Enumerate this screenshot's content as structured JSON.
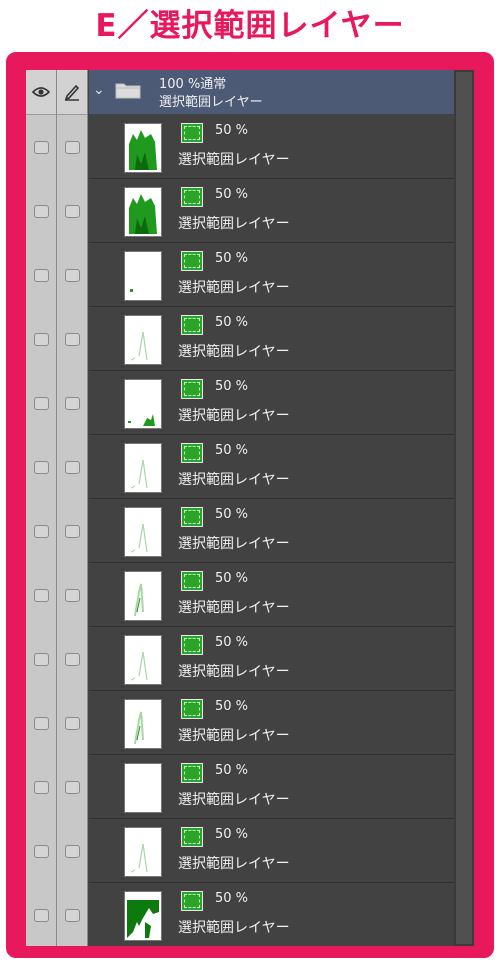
{
  "title": "E／選択範囲レイヤー",
  "colors": {
    "accent": "#e8185c",
    "group_header": "#4d5a76",
    "panel": "#424242",
    "mask": "#2aa52a"
  },
  "columns": {
    "visibility_icon": "eye-icon",
    "edit_icon": "pen-icon"
  },
  "group": {
    "expand_icon": "chevron-down-icon",
    "folder_icon": "folder-icon",
    "blend": "100 %通常",
    "name": "選択範囲レイヤー"
  },
  "layers": [
    {
      "opacity": "50 %",
      "name": "選択範囲レイヤー",
      "mask_icon": "layer-mask-icon",
      "thumb": "dense"
    },
    {
      "opacity": "50 %",
      "name": "選択範囲レイヤー",
      "mask_icon": "layer-mask-icon",
      "thumb": "dense"
    },
    {
      "opacity": "50 %",
      "name": "選択範囲レイヤー",
      "mask_icon": "layer-mask-icon",
      "thumb": "dot"
    },
    {
      "opacity": "50 %",
      "name": "選択範囲レイヤー",
      "mask_icon": "layer-mask-icon",
      "thumb": "faint"
    },
    {
      "opacity": "50 %",
      "name": "選択範囲レイヤー",
      "mask_icon": "layer-mask-icon",
      "thumb": "bottom-right"
    },
    {
      "opacity": "50 %",
      "name": "選択範囲レイヤー",
      "mask_icon": "layer-mask-icon",
      "thumb": "faint"
    },
    {
      "opacity": "50 %",
      "name": "選択範囲レイヤー",
      "mask_icon": "layer-mask-icon",
      "thumb": "faint"
    },
    {
      "opacity": "50 %",
      "name": "選択範囲レイヤー",
      "mask_icon": "layer-mask-icon",
      "thumb": "stroke"
    },
    {
      "opacity": "50 %",
      "name": "選択範囲レイヤー",
      "mask_icon": "layer-mask-icon",
      "thumb": "faint"
    },
    {
      "opacity": "50 %",
      "name": "選択範囲レイヤー",
      "mask_icon": "layer-mask-icon",
      "thumb": "stroke"
    },
    {
      "opacity": "50 %",
      "name": "選択範囲レイヤー",
      "mask_icon": "layer-mask-icon",
      "thumb": "empty"
    },
    {
      "opacity": "50 %",
      "name": "選択範囲レイヤー",
      "mask_icon": "layer-mask-icon",
      "thumb": "faint"
    },
    {
      "opacity": "50 %",
      "name": "選択範囲レイヤー",
      "mask_icon": "layer-mask-icon",
      "thumb": "blob"
    }
  ]
}
